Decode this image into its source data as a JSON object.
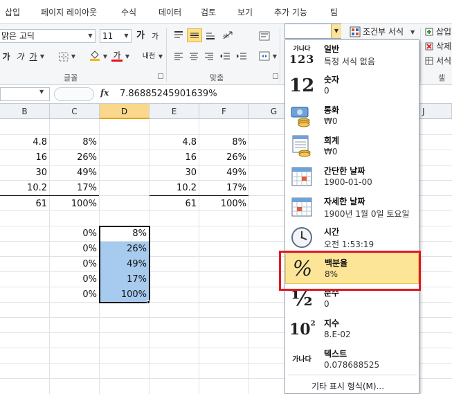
{
  "menubar": {
    "tabs": [
      "삽입",
      "페이지 레이아웃",
      "수식",
      "데이터",
      "검토",
      "보기",
      "추가 기능",
      "팀"
    ]
  },
  "ribbon": {
    "font_name": "맑은 고딕",
    "font_size": "11",
    "bold_glyph": "가",
    "italic_glyph": "가",
    "underline_glyph": "가",
    "fill_glyph": "◇",
    "fontcolor_glyph": "가",
    "phonetic_glyph": "내천",
    "grow_glyph": "가",
    "shrink_glyph": "가",
    "group_font": "글꼴",
    "group_align": "맞춤",
    "group_cells": "셀",
    "cond_format": "조건부 서식",
    "insert": "삽입",
    "delete": "삭제",
    "format": "서식",
    "colors": {
      "fill": "#f5b800",
      "fontcolor": "#e8101a"
    }
  },
  "formula_bar": {
    "fx": "fx",
    "value": "7.86885245901639%"
  },
  "sheet": {
    "columns": [
      "B",
      "C",
      "D",
      "E",
      "F",
      "G",
      "J"
    ],
    "selected_column": "D",
    "rows": [
      {
        "B": "4.8",
        "C": "8%",
        "E": "4.8",
        "F": "8%"
      },
      {
        "B": "16",
        "C": "26%",
        "E": "16",
        "F": "26%"
      },
      {
        "B": "30",
        "C": "49%",
        "E": "30",
        "F": "49%"
      },
      {
        "B": "10.2",
        "C": "17%",
        "E": "10.2",
        "F": "17%"
      },
      {
        "B": "61",
        "C": "100%",
        "E": "61",
        "F": "100%"
      }
    ],
    "lower_rows": [
      {
        "C": "0%",
        "D": "8%"
      },
      {
        "C": "0%",
        "D": "26%"
      },
      {
        "C": "0%",
        "D": "49%"
      },
      {
        "C": "0%",
        "D": "17%"
      },
      {
        "C": "0%",
        "D": "100%"
      }
    ],
    "selection_color": "#a7cbee"
  },
  "format_menu": {
    "items": [
      {
        "title": "일반",
        "sub": "특정 서식 없음",
        "icon": "general-icon",
        "glyph_top": "가나다",
        "glyph_bottom": "123"
      },
      {
        "title": "숫자",
        "sub": "0",
        "icon": "number-icon",
        "glyph": "12"
      },
      {
        "title": "통화",
        "sub": "₩0",
        "icon": "currency-icon"
      },
      {
        "title": "회계",
        "sub": "₩0",
        "icon": "accounting-icon"
      },
      {
        "title": "간단한 날짜",
        "sub": "1900-01-00",
        "icon": "short-date-icon"
      },
      {
        "title": "자세한 날짜",
        "sub": "1900년 1월 0일 토요일",
        "icon": "long-date-icon"
      },
      {
        "title": "시간",
        "sub": "오전 1:53:19",
        "icon": "clock-icon"
      },
      {
        "title": "백분율",
        "sub": "8%",
        "icon": "percent-icon",
        "glyph": "%"
      },
      {
        "title": "분수",
        "sub": "0",
        "icon": "fraction-icon",
        "glyph": "½"
      },
      {
        "title": "지수",
        "sub": "8.E-02",
        "icon": "scientific-icon",
        "glyph": "10"
      },
      {
        "title": "텍스트",
        "sub": "0.078688525",
        "icon": "text-icon",
        "glyph": "가나다"
      }
    ],
    "more": "기타 표시 형식(M)...",
    "highlight_color": "#fde597",
    "callout_color": "#e11722"
  }
}
